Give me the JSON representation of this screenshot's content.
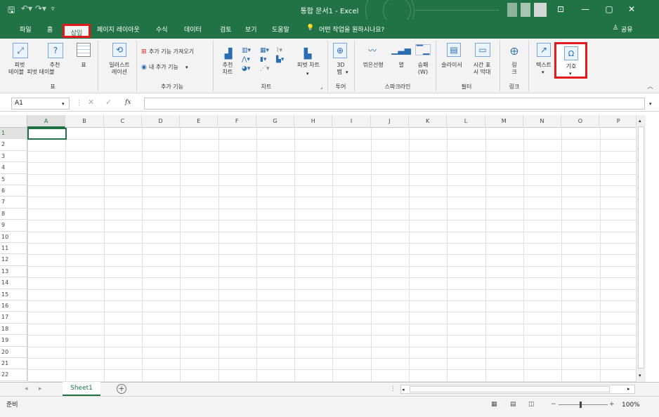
{
  "title_bar": {
    "document_title": "통합 문서1 - Excel",
    "quick_access": [
      "save-icon",
      "undo-icon",
      "redo-icon",
      "customize-icon"
    ],
    "window_buttons": [
      "ribbon-display-icon",
      "minimize-icon",
      "maximize-icon",
      "close-icon"
    ]
  },
  "tabs": {
    "file": "파일",
    "home": "홈",
    "insert": "삽입",
    "page_layout": "페이지 레이아웃",
    "formulas": "수식",
    "data": "데이터",
    "review": "검토",
    "view": "보기",
    "help": "도움말",
    "tell_me": "어떤 작업을 원하시나요?",
    "share": "공유"
  },
  "ribbon": {
    "tables": {
      "pivot_table": [
        "피벗",
        "테이블"
      ],
      "recommended_pivot": [
        "추천",
        "피벗 테이블"
      ],
      "table": "표",
      "group": "표"
    },
    "illustrations": {
      "label": [
        "일러스트",
        "레이션"
      ]
    },
    "addins": {
      "get_addins": "추가 기능 가져오기",
      "my_addins": "내 추가 기능",
      "group": "추가 기능"
    },
    "charts": {
      "recommended": [
        "추천",
        "차트"
      ],
      "pivot_chart": "피벗 차트",
      "group": "차트"
    },
    "tours": {
      "map3d": [
        "3D",
        "맵"
      ],
      "group": "투어"
    },
    "sparklines": {
      "line": "꺾은선형",
      "column": "열",
      "winloss": [
        "승패",
        "(W)"
      ],
      "group": "스파크라인"
    },
    "filters": {
      "slicer": "슬라이서",
      "timeline": [
        "시간 표",
        "시 막대"
      ],
      "group": "필터"
    },
    "links": {
      "link": [
        "링",
        "크"
      ],
      "group": "링크"
    },
    "text": {
      "label": "텍스트"
    },
    "symbols": {
      "label": "기호"
    }
  },
  "formula_bar": {
    "name_box": "A1",
    "fx": "fx",
    "formula": ""
  },
  "columns": [
    "A",
    "B",
    "C",
    "D",
    "E",
    "F",
    "G",
    "H",
    "I",
    "J",
    "K",
    "L",
    "M",
    "N",
    "O",
    "P"
  ],
  "rows": [
    "1",
    "2",
    "3",
    "4",
    "5",
    "6",
    "7",
    "8",
    "9",
    "10",
    "11",
    "12",
    "13",
    "14",
    "15",
    "16",
    "17",
    "18",
    "19",
    "20",
    "21",
    "22"
  ],
  "sheet_tabs": {
    "active": "Sheet1",
    "add": "+"
  },
  "status": {
    "ready": "준비",
    "zoom": "100%"
  },
  "colors": {
    "excel_green": "#217346",
    "highlight_red": "#e3191e"
  }
}
